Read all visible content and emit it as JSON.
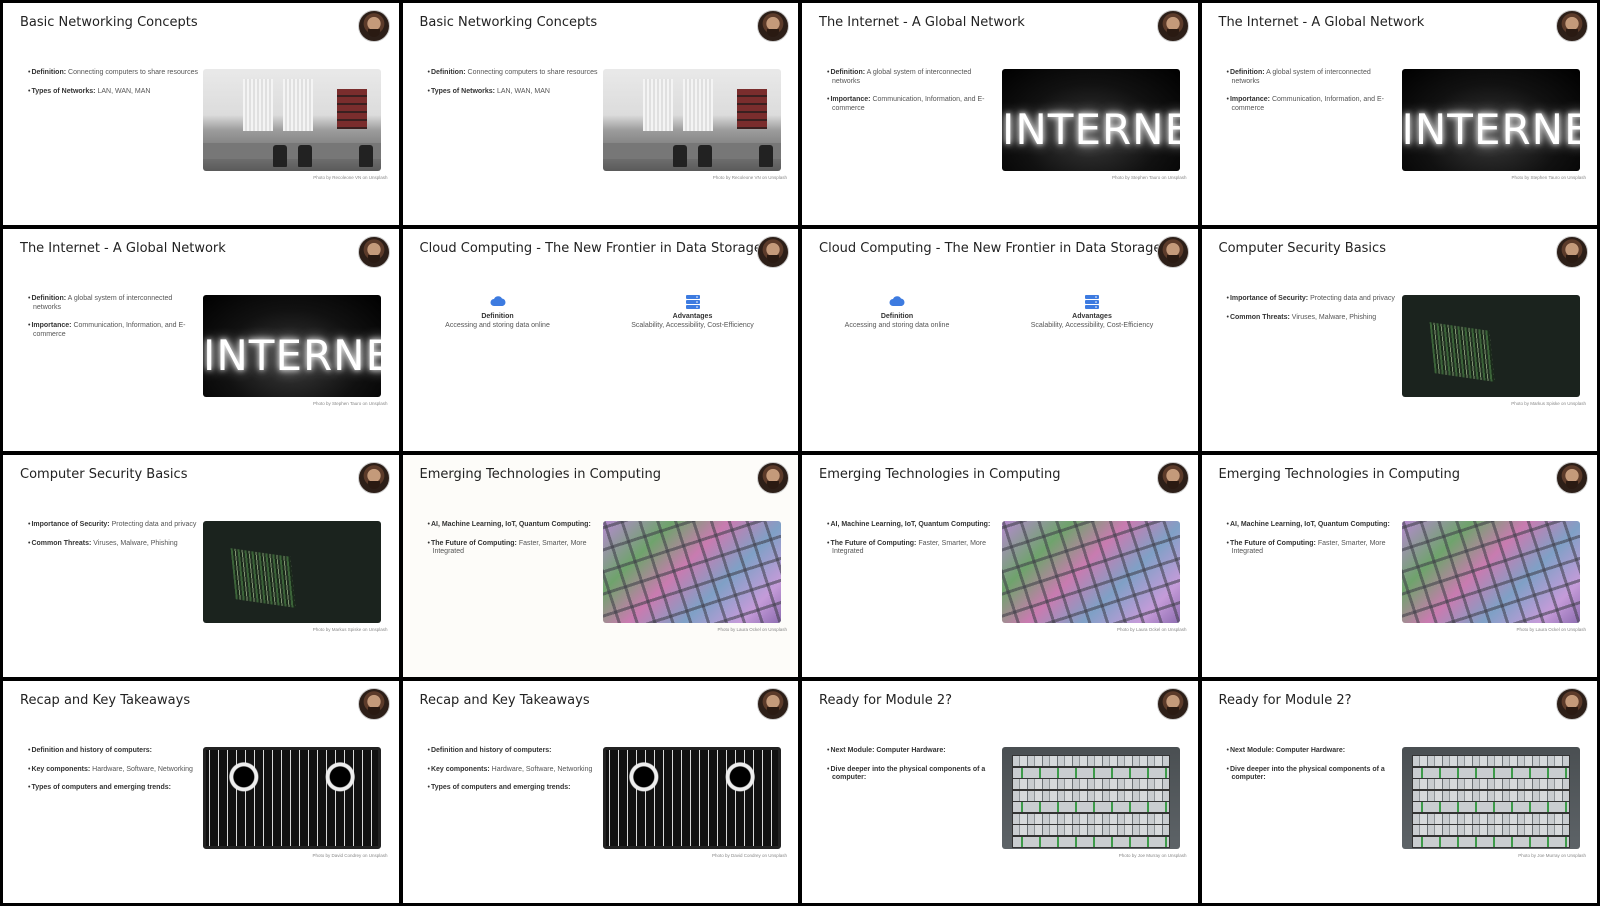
{
  "slides": [
    {
      "title": "Basic Networking Concepts",
      "bullets": [
        {
          "term": "Definition:",
          "text": " Connecting computers to share resources"
        },
        {
          "term": "Types of Networks:",
          "text": " LAN, WAN, MAN"
        }
      ],
      "photo": "office",
      "credit": "Photo by Recoleone VN on Unsplash"
    },
    {
      "title": "Basic Networking Concepts",
      "bullets": [
        {
          "term": "Definition:",
          "text": " Connecting computers to share resources"
        },
        {
          "term": "Types of Networks:",
          "text": " LAN, WAN, MAN"
        }
      ],
      "photo": "office",
      "credit": "Photo by Recoleone VN on Unsplash"
    },
    {
      "title": "The Internet - A Global Network",
      "bullets": [
        {
          "term": "Definition:",
          "text": " A global system of interconnected networks"
        },
        {
          "term": "Importance:",
          "text": " Communication, Information, and E-commerce"
        }
      ],
      "photo": "internet",
      "photo_text": "INTERNET",
      "credit": "Photo by Stephen Tauro on Unsplash"
    },
    {
      "title": "The Internet - A Global Network",
      "bullets": [
        {
          "term": "Definition:",
          "text": " A global system of interconnected networks"
        },
        {
          "term": "Importance:",
          "text": " Communication, Information, and E-commerce"
        }
      ],
      "photo": "internet",
      "photo_text": "INTERNET",
      "credit": "Photo by Stephen Tauro on Unsplash"
    },
    {
      "title": "The Internet - A Global Network",
      "bullets": [
        {
          "term": "Definition:",
          "text": " A global system of interconnected networks"
        },
        {
          "term": "Importance:",
          "text": " Communication, Information, and E-commerce"
        }
      ],
      "photo": "internet",
      "photo_text": "INTERNET",
      "credit": "Photo by Stephen Tauro on Unsplash"
    },
    {
      "title": "Cloud Computing - The New Frontier in Data Storage",
      "layout": "columns",
      "columns": [
        {
          "icon": "cloud-icon",
          "heading": "Definition",
          "text": "Accessing and storing data online"
        },
        {
          "icon": "server-icon",
          "heading": "Advantages",
          "text": "Scalability, Accessibility, Cost-Efficiency"
        }
      ]
    },
    {
      "title": "Cloud Computing - The New Frontier in Data Storage",
      "layout": "columns",
      "columns": [
        {
          "icon": "cloud-icon",
          "heading": "Definition",
          "text": "Accessing and storing data online"
        },
        {
          "icon": "server-icon",
          "heading": "Advantages",
          "text": "Scalability, Accessibility, Cost-Efficiency"
        }
      ]
    },
    {
      "title": "Computer Security Basics",
      "bullets": [
        {
          "term": "Importance of Security:",
          "text": " Protecting data and privacy"
        },
        {
          "term": "Common Threats:",
          "text": " Viruses, Malware, Phishing"
        }
      ],
      "photo": "security",
      "credit": "Photo by Markus Spiske on Unsplash"
    },
    {
      "title": "Computer Security Basics",
      "bullets": [
        {
          "term": "Importance of Security:",
          "text": " Protecting data and privacy"
        },
        {
          "term": "Common Threats:",
          "text": " Viruses, Malware, Phishing"
        }
      ],
      "photo": "security",
      "credit": "Photo by Markus Spiske on Unsplash"
    },
    {
      "title": "Emerging Technologies in Computing",
      "bullets": [
        {
          "term": "AI, Machine Learning, IoT, Quantum Computing:",
          "text": ""
        },
        {
          "term": "The Future of Computing:",
          "text": " Faster, Smarter, More Integrated"
        }
      ],
      "photo": "chip",
      "credit": "Photo by Laura Ockel on Unsplash",
      "offwhite": true
    },
    {
      "title": "Emerging Technologies in Computing",
      "bullets": [
        {
          "term": "AI, Machine Learning, IoT, Quantum Computing:",
          "text": ""
        },
        {
          "term": "The Future of Computing:",
          "text": " Faster, Smarter, More Integrated"
        }
      ],
      "photo": "chip",
      "credit": "Photo by Laura Ockel on Unsplash"
    },
    {
      "title": "Emerging Technologies in Computing",
      "bullets": [
        {
          "term": "AI, Machine Learning, IoT, Quantum Computing:",
          "text": ""
        },
        {
          "term": "The Future of Computing:",
          "text": " Faster, Smarter, More Integrated"
        }
      ],
      "photo": "chip",
      "credit": "Photo by Laura Ockel on Unsplash"
    },
    {
      "title": "Recap and Key Takeaways",
      "bullets": [
        {
          "term": "Definition and history of computers:",
          "text": ""
        },
        {
          "term": "Key components:",
          "text": " Hardware, Software, Networking"
        },
        {
          "term": "Types of computers and emerging trends:",
          "text": ""
        }
      ],
      "photo": "board",
      "credit": "Photo by David Condrey on Unsplash"
    },
    {
      "title": "Recap and Key Takeaways",
      "bullets": [
        {
          "term": "Definition and history of computers:",
          "text": ""
        },
        {
          "term": "Key components:",
          "text": " Hardware, Software, Networking"
        },
        {
          "term": "Types of computers and emerging trends:",
          "text": ""
        }
      ],
      "photo": "board",
      "credit": "Photo by David Condrey on Unsplash"
    },
    {
      "title": "Ready for Module 2?",
      "bullets": [
        {
          "term": "Next Module: Computer Hardware:",
          "text": ""
        },
        {
          "term": "Dive deeper into the physical components of a computer:",
          "text": ""
        }
      ],
      "photo": "rack",
      "credit": "Photo by Joe Murray on Unsplash"
    },
    {
      "title": "Ready for Module 2?",
      "bullets": [
        {
          "term": "Next Module: Computer Hardware:",
          "text": ""
        },
        {
          "term": "Dive deeper into the physical components of a computer:",
          "text": ""
        }
      ],
      "photo": "rack",
      "credit": "Photo by Joe Murray on Unsplash"
    }
  ],
  "colors": {
    "accent": "#3d7be0",
    "background": "#000000",
    "slide": "#ffffff"
  }
}
